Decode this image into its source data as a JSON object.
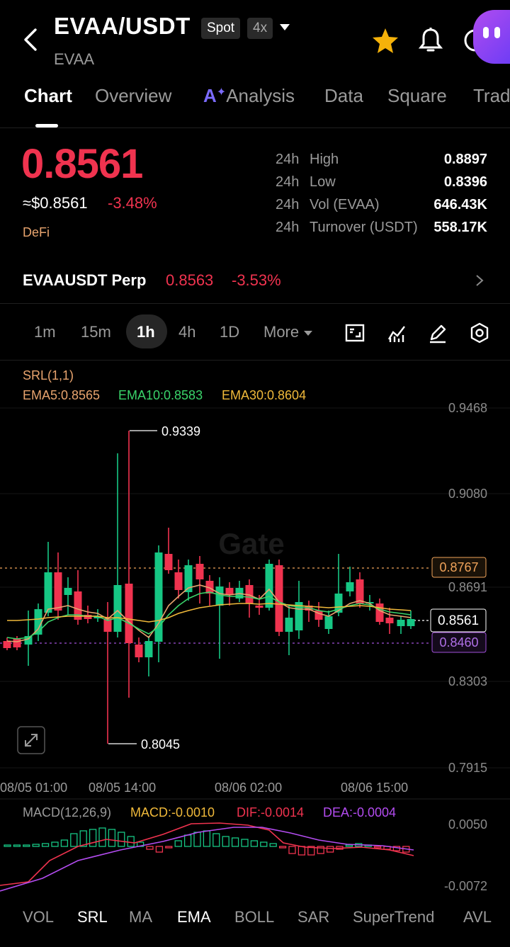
{
  "header": {
    "pair": "EVAA/USDT",
    "subname": "EVAA",
    "tag_spot": "Spot",
    "tag_leverage": "4x"
  },
  "tabs": [
    {
      "label": "Chart",
      "active": true
    },
    {
      "label": "Overview"
    },
    {
      "label": "Analysis",
      "prefix": "A"
    },
    {
      "label": "Data"
    },
    {
      "label": "Square"
    },
    {
      "label": "Trad"
    }
  ],
  "price": {
    "last": "0.8561",
    "usd": "≈$0.8561",
    "change": "-3.48%",
    "category": "DeFi"
  },
  "stats": [
    {
      "period": "24h",
      "label": "High",
      "value": "0.8897"
    },
    {
      "period": "24h",
      "label": "Low",
      "value": "0.8396"
    },
    {
      "period": "24h",
      "label": "Vol (EVAA)",
      "value": "646.43K"
    },
    {
      "period": "24h",
      "label": "Turnover (USDT)",
      "value": "558.17K"
    }
  ],
  "perp": {
    "name": "EVAAUSDT Perp",
    "price": "0.8563",
    "change": "-3.53%"
  },
  "intervals": [
    "1m",
    "15m",
    "1h",
    "4h",
    "1D"
  ],
  "interval_active": "1h",
  "interval_more": "More",
  "chart": {
    "srl_label": "SRL(1,1)",
    "ema5": "EMA5:0.8565",
    "ema10": "EMA10:0.8583",
    "ema30": "EMA30:0.8604",
    "max_label": "0.9339",
    "min_label": "0.8045",
    "ref_high": "0.8767",
    "current": "0.8561",
    "ref_low": "0.8460",
    "watermark": "Gate",
    "y_ticks": [
      "0.9468",
      "0.9080",
      "0.8691",
      "0.8303",
      "0.7915"
    ],
    "time_ticks": [
      "08/05 01:00",
      "08/05 14:00",
      "08/06 02:00",
      "08/06 15:00"
    ],
    "colors": {
      "up": "#16c784",
      "down": "#f0334f",
      "ema5": "#e8a46e",
      "ema10": "#3ad46a",
      "ema30": "#f0b93a",
      "macd_dif": "#f0334f",
      "macd_dea": "#b34cf0"
    }
  },
  "macd": {
    "label": "MACD(12,26,9)",
    "macd": "MACD:-0.0010",
    "dif": "DIF:-0.0014",
    "dea": "DEA:-0.0004",
    "y_top": "0.0050",
    "y_bottom": "-0.0072"
  },
  "bottom_tabs": [
    {
      "label": "VOL"
    },
    {
      "label": "SRL",
      "on": true
    },
    {
      "label": "MA"
    },
    {
      "label": "EMA",
      "on": true
    },
    {
      "label": "BOLL"
    },
    {
      "label": "SAR"
    },
    {
      "label": "SuperTrend"
    },
    {
      "label": "AVL"
    }
  ]
}
